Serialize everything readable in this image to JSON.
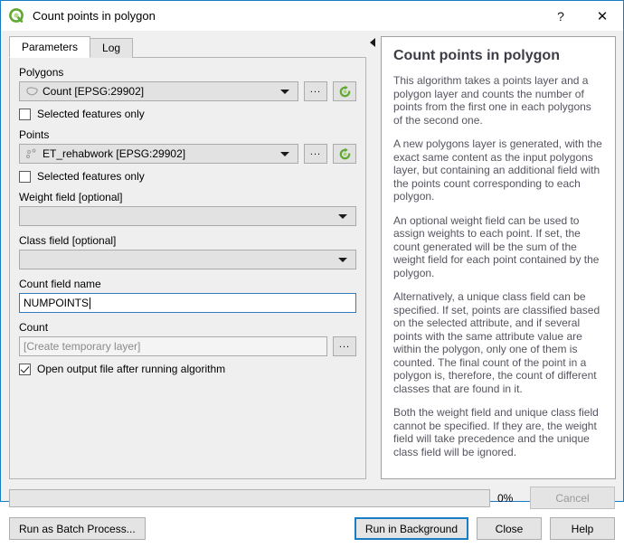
{
  "window": {
    "title": "Count points in polygon",
    "logo_icon": "qgis-logo-icon",
    "help_button": "?",
    "close_button": "✕"
  },
  "tabs": [
    {
      "label": "Parameters",
      "active": true
    },
    {
      "label": "Log",
      "active": false
    }
  ],
  "parameters": {
    "polygons": {
      "label": "Polygons",
      "value": "Count [EPSG:29902]",
      "layer_icon": "polygon-layer-icon",
      "browse_label": "...",
      "iterate_icon": "refresh-icon",
      "selected_only_label": "Selected features only",
      "selected_only_checked": false
    },
    "points": {
      "label": "Points",
      "value": "ET_rehabwork [EPSG:29902]",
      "layer_icon": "point-layer-icon",
      "browse_label": "...",
      "iterate_icon": "refresh-icon",
      "selected_only_label": "Selected features only",
      "selected_only_checked": false
    },
    "weight_field": {
      "label": "Weight field [optional]",
      "value": ""
    },
    "class_field": {
      "label": "Class field [optional]",
      "value": ""
    },
    "count_field_name": {
      "label": "Count field name",
      "value": "NUMPOINTS"
    },
    "output": {
      "label": "Count",
      "placeholder": "[Create temporary layer]",
      "browse_label": "...",
      "open_output_label": "Open output file after running algorithm",
      "open_output_checked": true
    }
  },
  "help": {
    "title": "Count points in polygon",
    "paragraphs": [
      "This algorithm takes a points layer and a polygon layer and counts the number of points from the first one in each polygons of the second one.",
      "A new polygons layer is generated, with the exact same content as the input polygons layer, but containing an additional field with the points count corresponding to each polygon.",
      "An optional weight field can be used to assign weights to each point. If set, the count generated will be the sum of the weight field for each point contained by the polygon.",
      "Alternatively, a unique class field can be specified. If set, points are classified based on the selected attribute, and if several points with the same attribute value are within the polygon, only one of them is counted. The final count of the point in a polygon is, therefore, the count of different classes that are found in it.",
      "Both the weight field and unique class field cannot be specified. If they are, the weight field will take precedence and the unique class field will be ignored."
    ]
  },
  "footer": {
    "progress_percent": "0%",
    "progress_value": 0,
    "cancel_label": "Cancel",
    "cancel_disabled": true,
    "batch_label": "Run as Batch Process...",
    "run_label": "Run in Background",
    "close_label": "Close",
    "help_label": "Help"
  },
  "colors": {
    "accent": "#1a7dc4",
    "qgis_green": "#5fa832",
    "help_text": "#55555f"
  }
}
